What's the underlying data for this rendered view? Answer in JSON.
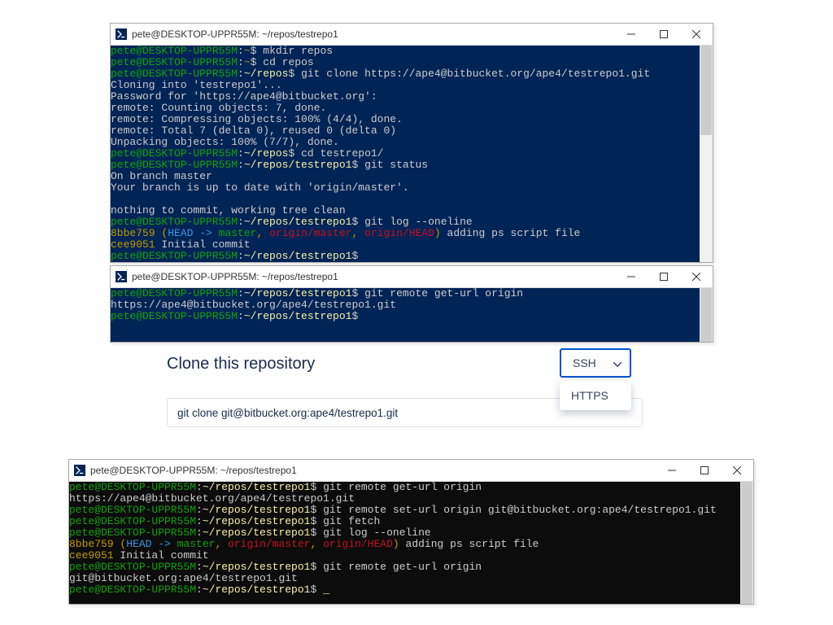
{
  "colors": {
    "terminal_bg_blue": "#012456",
    "terminal_bg_black": "#0c0c0c",
    "green": "#13a10e",
    "dark_yellow": "#c19c00",
    "gold": "#f9f1a5",
    "red": "#c50f1f",
    "cyan": "#3a96dd",
    "accent_blue": "#0052cc"
  },
  "window1": {
    "title": "pete@DESKTOP-UPPR55M: ~/repos/testrepo1",
    "prompt_user": "pete@DESKTOP-UPPR55M",
    "tilde": "~",
    "home_dollar": "$ ",
    "dollar": "$ ",
    "cmd_mkdir": "mkdir repos",
    "cmd_cd_repos": "cd repos",
    "path_repos": "~/repos",
    "cmd_clone": "git clone https://ape4@bitbucket.org/ape4/testrepo1.git",
    "out_cloning": "Cloning into 'testrepo1'...",
    "out_pw": "Password for 'https://ape4@bitbucket.org':",
    "out_count": "remote: Counting objects: 7, done.",
    "out_compress": "remote: Compressing objects: 100% (4/4), done.",
    "out_total": "remote: Total 7 (delta 0), reused 0 (delta 0)",
    "out_unpack": "Unpacking objects: 100% (7/7), done.",
    "cmd_cd_tr": "cd testrepo1/",
    "path_tr": "~/repos/testrepo1",
    "cmd_status": "git status",
    "out_branch": "On branch master",
    "out_up2date": "Your branch is up to date with 'origin/master'.",
    "out_nothing": "nothing to commit, working tree clean",
    "cmd_log": "git log --oneline",
    "log_hash1": "8bbe759",
    "log_open": " (",
    "log_head": "HEAD -> ",
    "log_master": "master",
    "log_sep": ", ",
    "log_om": "origin/master",
    "log_oh": "origin/HEAD",
    "log_close": ") ",
    "log_msg1": "adding ps script file",
    "log_hash2": "cee9051",
    "log_msg2": " Initial commit"
  },
  "window2": {
    "title": "pete@DESKTOP-UPPR55M: ~/repos/testrepo1",
    "prompt_user": "pete@DESKTOP-UPPR55M",
    "path_tr": "~/repos/testrepo1",
    "dollar": "$ ",
    "cmd_geturl": "git remote get-url origin",
    "out_url": "https://ape4@bitbucket.org/ape4/testrepo1.git"
  },
  "clone": {
    "title": "Clone this repository",
    "command": "git clone git@bitbucket.org:ape4/testrepo1.git",
    "selected_proto": "SSH",
    "option_https": "HTTPS"
  },
  "window3": {
    "title": "pete@DESKTOP-UPPR55M: ~/repos/testrepo1",
    "prompt_user": "pete@DESKTOP-UPPR55M",
    "path_tr": "~/repos/testrepo1",
    "dollar": "$ ",
    "cmd_geturl1": "git remote get-url origin",
    "out_url_https": "https://ape4@bitbucket.org/ape4/testrepo1.git",
    "cmd_seturl": "git remote set-url origin git@bitbucket.org:ape4/testrepo1.git",
    "cmd_fetch": "git fetch",
    "cmd_log": "git log --oneline",
    "log_hash1": "8bbe759",
    "log_open": " (",
    "log_head": "HEAD -> ",
    "log_master": "master",
    "log_sep": ", ",
    "log_om": "origin/master",
    "log_oh": "origin/HEAD",
    "log_close": ") ",
    "log_msg1": "adding ps script file",
    "log_hash2": "cee9051",
    "log_msg2": " Initial commit",
    "cmd_geturl2": "git remote get-url origin",
    "out_url_ssh": "git@bitbucket.org:ape4/testrepo1.git",
    "cursor": "_"
  }
}
